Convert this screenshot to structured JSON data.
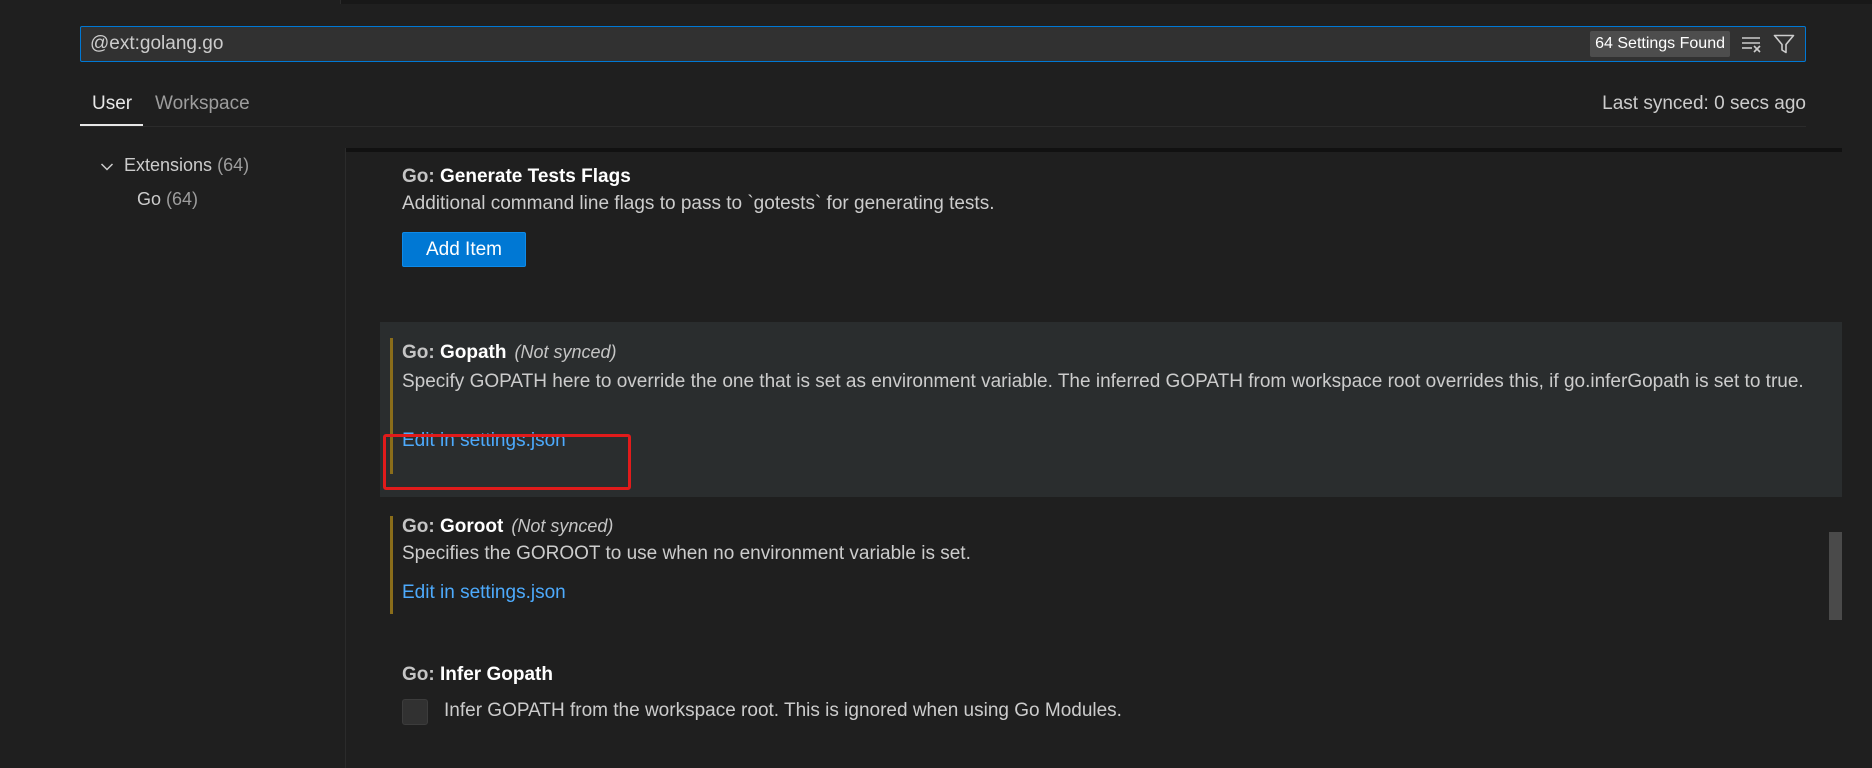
{
  "search": {
    "value": "@ext:golang.go",
    "results_badge": "64 Settings Found",
    "clear_icon": "clear-filter-icon",
    "filter_icon": "filter-icon"
  },
  "scope_tabs": {
    "user": "User",
    "workspace": "Workspace",
    "active": "User",
    "last_synced": "Last synced: 0 secs ago"
  },
  "toc": {
    "extensions": {
      "label": "Extensions",
      "count": "(64)"
    },
    "go": {
      "label": "Go",
      "count": "(64)"
    }
  },
  "settings": [
    {
      "category": "Go: ",
      "name": "Generate Tests Flags",
      "description": "Additional command line flags to pass to `gotests` for generating tests.",
      "button": "Add Item"
    },
    {
      "category": "Go: ",
      "name": "Gopath",
      "not_synced": "(Not synced)",
      "description": "Specify GOPATH here to override the one that is set as environment variable. The inferred GOPATH from workspace root overrides this, if go.inferGopath is set to true.",
      "link": "Edit in settings.json"
    },
    {
      "category": "Go: ",
      "name": "Goroot",
      "not_synced": "(Not synced)",
      "description": "Specifies the GOROOT to use when no environment variable is set.",
      "link": "Edit in settings.json"
    },
    {
      "category": "Go: ",
      "name": "Infer Gopath",
      "checkbox_label": "Infer GOPATH from the workspace root. This is ignored when using Go Modules.",
      "checked": false
    }
  ],
  "colors": {
    "accent": "#0078d4",
    "link": "#4daafc",
    "modified_bar": "#8a6d1a",
    "highlight": "#e11b1b"
  }
}
